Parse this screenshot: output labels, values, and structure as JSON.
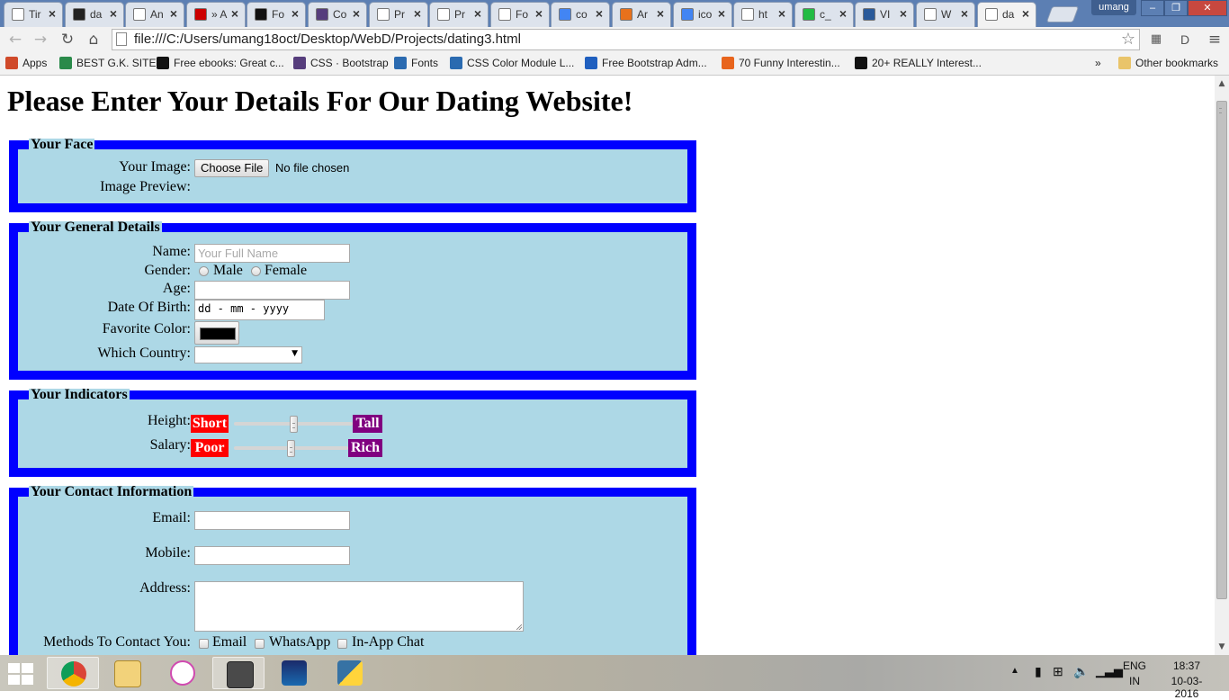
{
  "browser": {
    "tabs": [
      {
        "label": "Tir",
        "icon": "page-icon",
        "color": "#ffffff"
      },
      {
        "label": "da",
        "icon": "github-icon",
        "color": "#222222"
      },
      {
        "label": "An",
        "icon": "page-icon",
        "color": "#ffffff"
      },
      {
        "label": "» A",
        "icon": "youtube-icon",
        "color": "#cc0000"
      },
      {
        "label": "Fo",
        "icon": "flag-icon",
        "color": "#111111"
      },
      {
        "label": "Co",
        "icon": "bootstrap-icon",
        "color": "#563d7c"
      },
      {
        "label": "Pr",
        "icon": "page-icon",
        "color": "#ffffff"
      },
      {
        "label": "Pr",
        "icon": "page-icon",
        "color": "#ffffff"
      },
      {
        "label": "Fo",
        "icon": "page-icon",
        "color": "#ffffff"
      },
      {
        "label": "co",
        "icon": "google-icon",
        "color": "#4285f4"
      },
      {
        "label": "Ar",
        "icon": "android-icon",
        "color": "#e8711c"
      },
      {
        "label": "ico",
        "icon": "google-icon",
        "color": "#4285f4"
      },
      {
        "label": "ht",
        "icon": "page-icon",
        "color": "#ffffff"
      },
      {
        "label": "c_",
        "icon": "puzzle-icon",
        "color": "#22bb44"
      },
      {
        "label": "VI",
        "icon": "site-icon",
        "color": "#2a5a9a"
      },
      {
        "label": "W",
        "icon": "page-icon",
        "color": "#ffffff"
      },
      {
        "label": "da",
        "icon": "page-icon",
        "color": "#ffffff"
      }
    ],
    "user_name": "umang",
    "url": "file:///C:/Users/umang18oct/Desktop/WebD/Projects/dating3.html",
    "bookmarks": [
      {
        "label": "Apps",
        "icon": "apps-grid-icon",
        "color": "#d04a2a"
      },
      {
        "label": "BEST G.K. SITE",
        "icon": "site-icon",
        "color": "#2a8a4a"
      },
      {
        "label": "Free ebooks: Great c...",
        "icon": "m-icon",
        "color": "#111111"
      },
      {
        "label": "CSS · Bootstrap",
        "icon": "bootstrap-icon",
        "color": "#563d7c"
      },
      {
        "label": "Fonts",
        "icon": "w3-icon",
        "color": "#2a6ab0"
      },
      {
        "label": "CSS Color Module L...",
        "icon": "w3-icon",
        "color": "#2a6ab0"
      },
      {
        "label": "Free Bootstrap Adm...",
        "icon": "a-icon",
        "color": "#1f5fbf"
      },
      {
        "label": "70 Funny Interestin...",
        "icon": "b-icon",
        "color": "#e8641c"
      },
      {
        "label": "20+ REALLY Interest...",
        "icon": "s-icon",
        "color": "#111111"
      }
    ],
    "other_bookmarks": "Other bookmarks",
    "overflow": "»"
  },
  "page": {
    "heading": "Please Enter Your Details For Our Dating Website!",
    "face": {
      "legend": "Your Face",
      "image_label": "Your Image:",
      "file_button": "Choose File",
      "file_status": "No file chosen",
      "preview_label": "Image Preview:"
    },
    "general": {
      "legend": "Your General Details",
      "name_label": "Name:",
      "name_placeholder": "Your Full Name",
      "gender_label": "Gender:",
      "male": "Male",
      "female": "Female",
      "age_label": "Age:",
      "dob_label": "Date Of Birth:",
      "dob_value": "dd - mm - yyyy",
      "color_label": "Favorite Color:",
      "color_value": "#000000",
      "country_label": "Which Country:"
    },
    "indicators": {
      "legend": "Your Indicators",
      "height_label": "Height:",
      "height_min": "Short",
      "height_max": "Tall",
      "height_value": 0.5,
      "salary_label": "Salary:",
      "salary_min": "Poor",
      "salary_max": "Rich",
      "salary_value": 0.5,
      "min_color": "#ff0000",
      "max_color": "#800080"
    },
    "contact": {
      "legend": "Your Contact Information",
      "email_label": "Email:",
      "mobile_label": "Mobile:",
      "address_label": "Address:",
      "methods_label": "Methods To Contact You:",
      "methods": [
        "Email",
        "WhatsApp",
        "In-App Chat"
      ]
    },
    "colors": {
      "fieldset_bg": "#add8e6",
      "fieldset_border": "#0000ff"
    }
  },
  "taskbar": {
    "apps": [
      "chrome-icon",
      "file-explorer-icon",
      "itunes-icon",
      "sublime-text-icon",
      "cald3-icon",
      "python-icon"
    ],
    "language": "ENG",
    "region": "IN",
    "time": "18:37",
    "date": "10-03-2016"
  }
}
